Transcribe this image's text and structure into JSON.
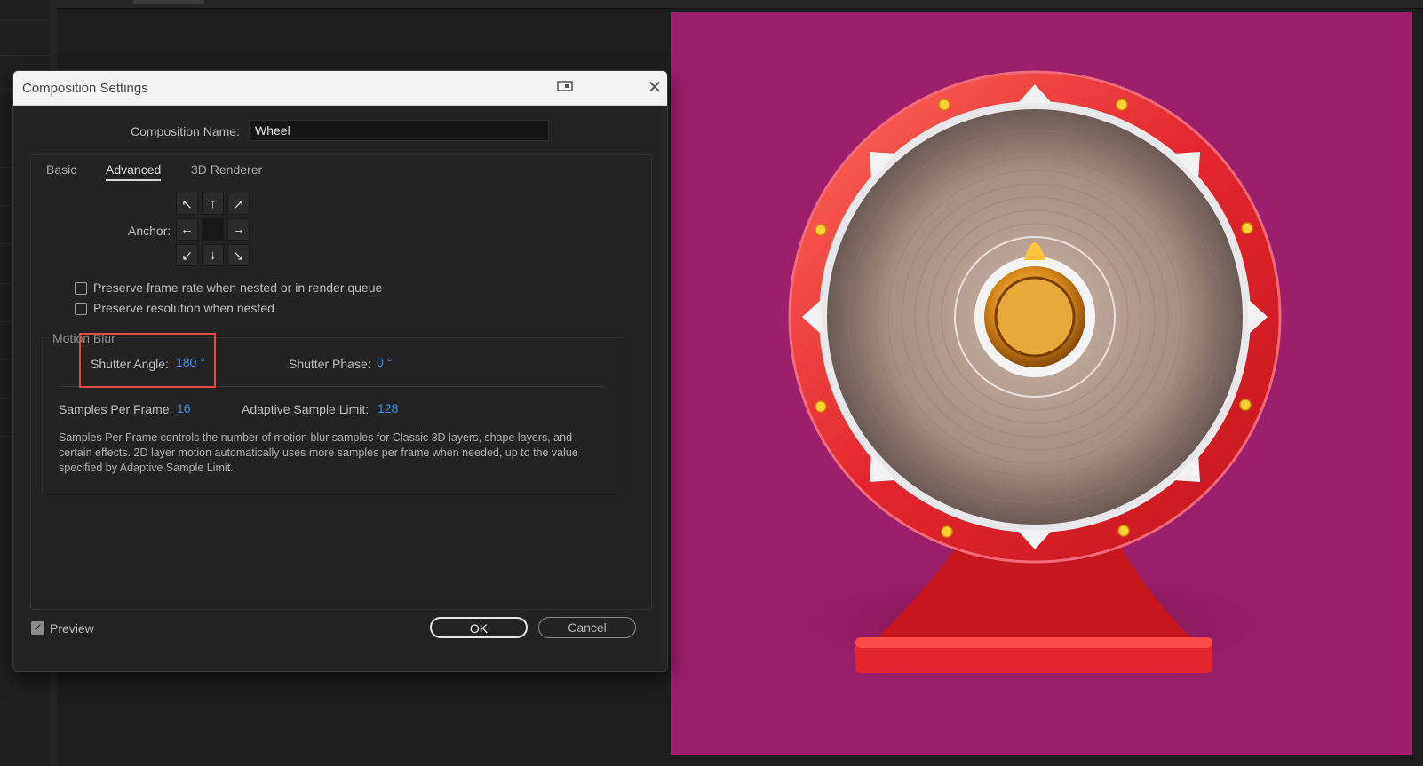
{
  "dialog": {
    "title": "Composition Settings",
    "composition_name_label": "Composition Name:",
    "composition_name_value": "Wheel",
    "tabs": [
      {
        "label": "Basic"
      },
      {
        "label": "Advanced"
      },
      {
        "label": "3D Renderer"
      }
    ],
    "active_tab": "Advanced",
    "anchor_label": "Anchor:",
    "anchor_arrows": [
      "↖",
      "↑",
      "↗",
      "←",
      "",
      "→",
      "↙",
      "↓",
      "↘"
    ],
    "checkboxes": [
      {
        "label": "Preserve frame rate when nested or in render queue",
        "checked": false
      },
      {
        "label": "Preserve resolution when nested",
        "checked": false
      }
    ],
    "motion_blur": {
      "group_title": "Motion Blur",
      "shutter_angle_label": "Shutter Angle:",
      "shutter_angle_value": "180 °",
      "shutter_phase_label": "Shutter Phase:",
      "shutter_phase_value": "0 °",
      "samples_per_frame_label": "Samples Per Frame:",
      "samples_per_frame_value": "16",
      "adaptive_sample_limit_label": "Adaptive Sample Limit:",
      "adaptive_sample_limit_value": "128",
      "description": "Samples Per Frame controls the number of motion blur samples for Classic 3D layers, shape layers, and certain effects. 2D layer motion automatically uses more samples per frame when needed, up to the value specified by Adaptive Sample Limit."
    },
    "preview_label": "Preview",
    "preview_checked": true,
    "ok_label": "OK",
    "cancel_label": "Cancel",
    "close_icon": "close-icon",
    "snap_icon": "window-snap-icon"
  },
  "colors": {
    "viewer_background": "#9b1f6a",
    "wheel_rim": "#e3262d",
    "value_blue": "#3d8fe8",
    "highlight_red": "#e04747"
  }
}
